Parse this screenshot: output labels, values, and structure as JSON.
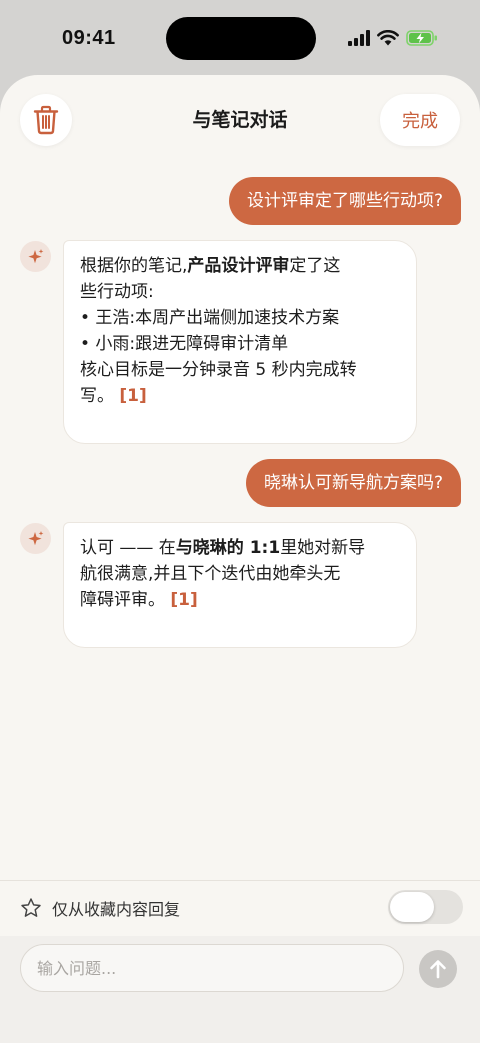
{
  "status_bar": {
    "time": "09:41"
  },
  "nav": {
    "title": "与笔记对话",
    "done_label": "完成"
  },
  "messages": {
    "q1": "设计评审定了哪些行动项?",
    "a1": {
      "l1_pre": "根据你的笔记,",
      "l1_bold": "产品设计评审",
      "l1_post": "定了这",
      "l2": "些行动项:",
      "l3": "• 王浩:本周产出端侧加速技术方案",
      "l4": "• 小雨:跟进无障碍审计清单",
      "l5": "核心目标是一分钟录音 5 秒内完成转",
      "l6": "写。",
      "cite": "[1]"
    },
    "q2": "晓琳认可新导航方案吗?",
    "a2": {
      "l1_pre": "认可 —— 在",
      "l1_bold": "与晓琳的 1:1",
      "l1_post": "里她对新导",
      "l2": "航很满意,并且下个迭代由她牵头无",
      "l3": "障碍评审。",
      "cite": "[1]"
    }
  },
  "favorites": {
    "label": "仅从收藏内容回复",
    "toggle_on": false
  },
  "input": {
    "placeholder": "输入问题..."
  },
  "colors": {
    "accent": "#cd6842",
    "background": "#f8f6f2"
  },
  "icons": [
    "trash-icon",
    "sparkle-icon",
    "star-icon",
    "arrow-up-icon"
  ]
}
